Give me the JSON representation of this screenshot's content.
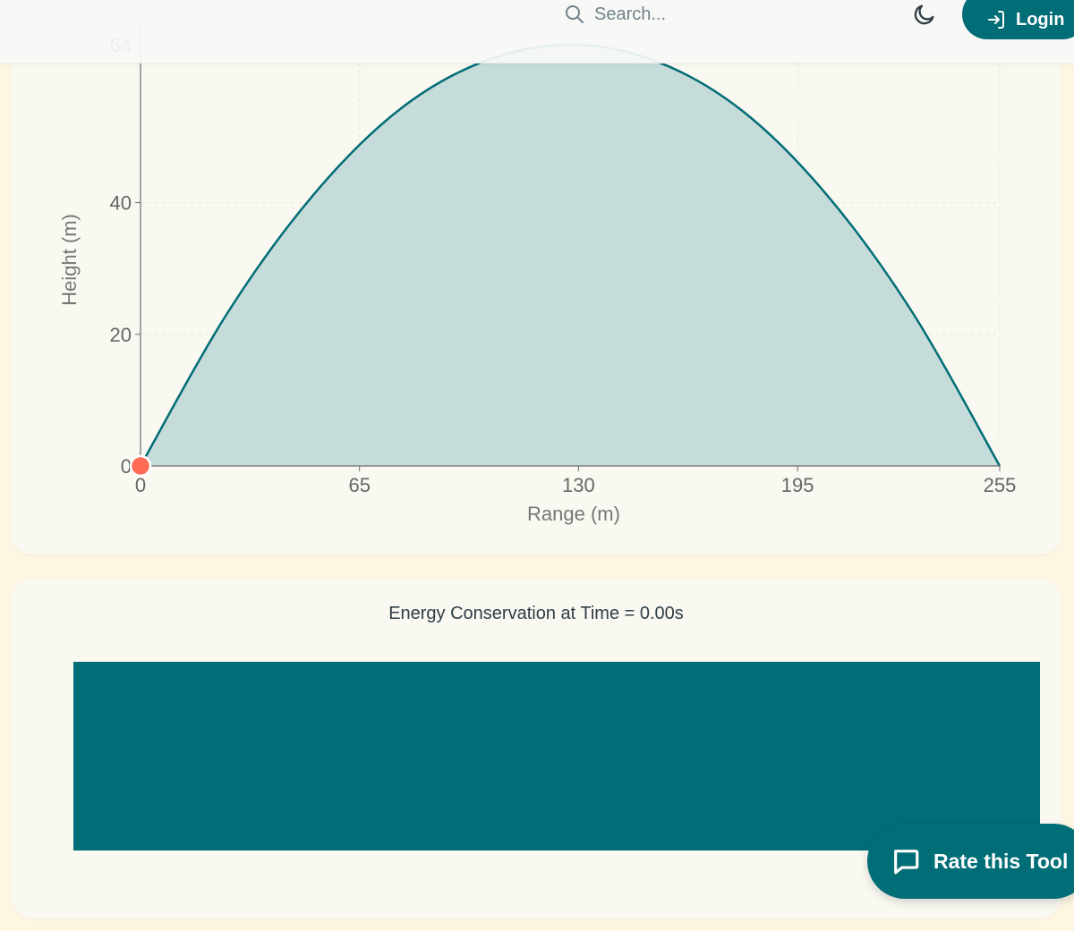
{
  "header": {
    "search_placeholder": "Search...",
    "login_label": "Login",
    "theme_icon": "moon-icon"
  },
  "trajectory_chart": {
    "chart_data": {
      "type": "area",
      "title": "",
      "xlabel": "Range (m)",
      "ylabel": "Height (m)",
      "xlim": [
        0,
        255
      ],
      "ylim": [
        0,
        64
      ],
      "x_ticks": [
        "0",
        "65",
        "130",
        "195",
        "255"
      ],
      "y_ticks": [
        "0",
        "20",
        "40",
        "64"
      ],
      "series": [
        {
          "x": [
            0,
            25.5,
            51,
            76.5,
            102,
            127.5,
            153,
            178.5,
            204,
            229.5,
            255
          ],
          "y": [
            0,
            23,
            41,
            54,
            61.5,
            64,
            61.5,
            54,
            41,
            23,
            0
          ]
        }
      ],
      "current_position": {
        "x": 0,
        "y": 0
      },
      "grid": true,
      "colors": {
        "line": "#006d77",
        "fill": "#c6dcda",
        "marker": "#ff6b57"
      }
    }
  },
  "energy_chart": {
    "title": "Energy Conservation at Time = 0.00s",
    "bar_color": "#006d77"
  },
  "rate_button": {
    "label": "Rate this Tool",
    "icon": "chat-bubble-icon"
  }
}
